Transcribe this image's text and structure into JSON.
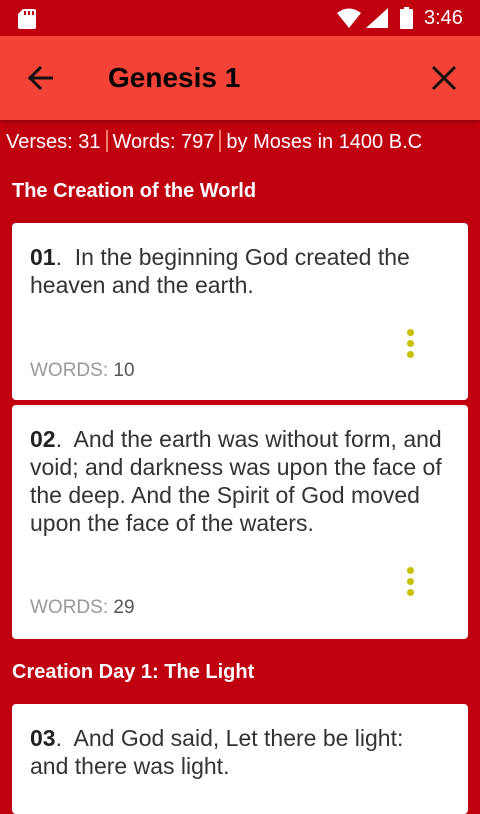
{
  "status_bar": {
    "time": "3:46",
    "icons": [
      "sd-card-icon",
      "wifi-icon",
      "signal-icon",
      "battery-icon"
    ]
  },
  "app_bar": {
    "title": "Genesis 1",
    "back_icon": "arrow-left-icon",
    "close_icon": "close-icon"
  },
  "meta": {
    "verses": "Verses: 31",
    "words": "Words: 797",
    "author": "by Moses in 1400 B.C"
  },
  "sections": [
    {
      "title": "The Creation of the World"
    },
    {
      "title": "Creation Day 1: The Light"
    }
  ],
  "verses": [
    {
      "number": "01",
      "text": "In the beginning God created the heaven and the earth.",
      "words_label": "WORDS:",
      "words": "10"
    },
    {
      "number": "02",
      "text": "And the earth was without form, and void; and darkness was upon the face of the deep. And the Spirit of God moved upon the face of the waters.",
      "words_label": "WORDS:",
      "words": "29"
    },
    {
      "number": "03",
      "text": "And God said, Let there be light: and there was light."
    }
  ],
  "colors": {
    "background": "#c0000f",
    "app_bar": "#f44336",
    "menu_dots": "#c9c000",
    "separator": "#f47b6b"
  }
}
